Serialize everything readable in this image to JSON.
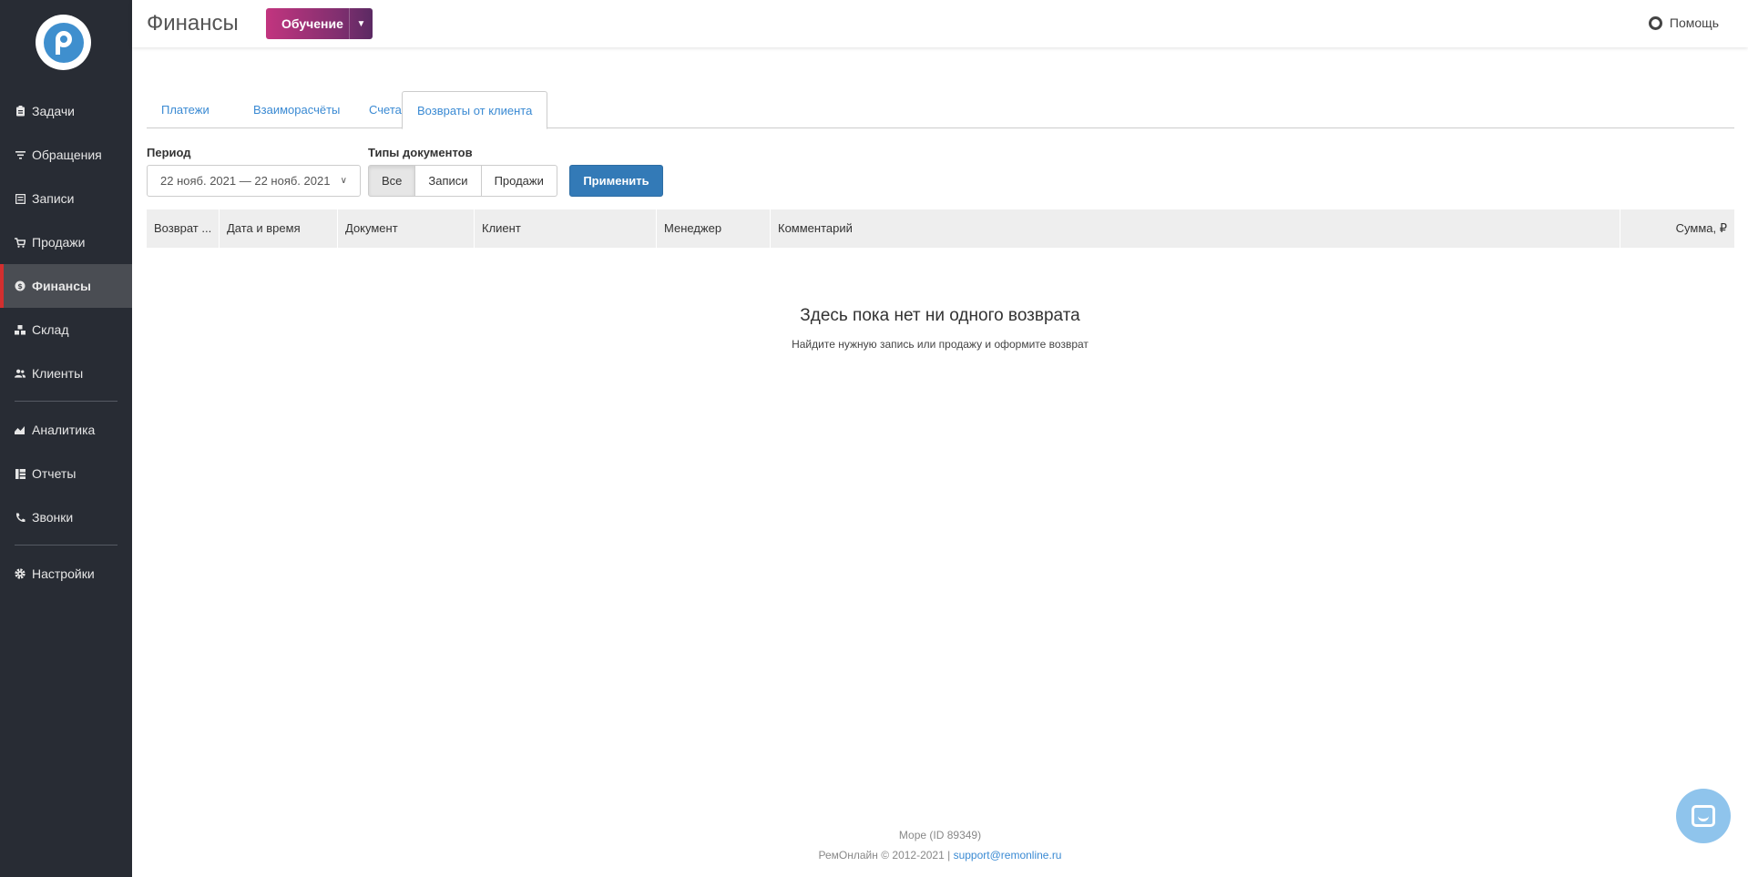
{
  "sidebar": {
    "items": [
      {
        "label": "Задачи",
        "icon": "clipboard-icon"
      },
      {
        "label": "Обращения",
        "icon": "funnel-icon"
      },
      {
        "label": "Записи",
        "icon": "orders-icon"
      },
      {
        "label": "Продажи",
        "icon": "cart-icon"
      },
      {
        "label": "Финансы",
        "icon": "finance-icon",
        "active": true
      },
      {
        "label": "Склад",
        "icon": "boxes-icon"
      },
      {
        "label": "Клиенты",
        "icon": "users-icon"
      },
      {
        "label": "Аналитика",
        "icon": "chart-icon"
      },
      {
        "label": "Отчеты",
        "icon": "reports-icon"
      },
      {
        "label": "Звонки",
        "icon": "phone-icon"
      },
      {
        "label": "Настройки",
        "icon": "gear-icon"
      }
    ]
  },
  "header": {
    "title": "Финансы",
    "learn_label": "Обучение",
    "help_label": "Помощь"
  },
  "tabs": [
    "Платежи",
    "Взаиморасчёты",
    "Счета",
    "Возвраты от клиента"
  ],
  "filters": {
    "period_label": "Период",
    "period_value": "22 нояб. 2021 — 22 нояб. 2021",
    "doc_types_label": "Типы документов",
    "doc_types": [
      "Все",
      "Записи",
      "Продажи"
    ],
    "apply_label": "Применить"
  },
  "table": {
    "columns": [
      "Возврат ...",
      "Дата и время",
      "Документ",
      "Клиент",
      "Менеджер",
      "Комментарий",
      "Сумма, ₽"
    ]
  },
  "empty": {
    "title": "Здесь пока нет ни одного возврата",
    "subtitle": "Найдите нужную запись или продажу и оформите возврат"
  },
  "footer": {
    "company": "Море (ID 89349)",
    "copyright": "РемОнлайн © 2012-2021 |",
    "email": "support@remonline.ru"
  },
  "colors": {
    "sidebar_bg": "#282c34",
    "active_marker": "#d32f2f",
    "primary": "#337ab7",
    "link": "#3a8ad3"
  }
}
